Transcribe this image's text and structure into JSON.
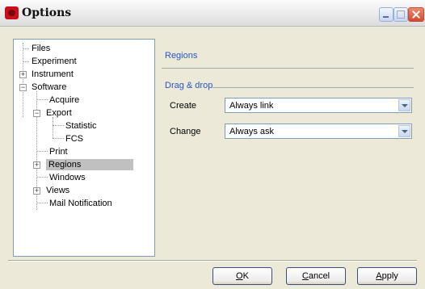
{
  "window": {
    "title": "Options"
  },
  "tree": {
    "items": [
      {
        "label": "Files"
      },
      {
        "label": "Experiment"
      },
      {
        "label": "Instrument"
      },
      {
        "label": "Software"
      },
      {
        "label": "Acquire"
      },
      {
        "label": "Export"
      },
      {
        "label": "Statistic"
      },
      {
        "label": "FCS"
      },
      {
        "label": "Print"
      },
      {
        "label": "Regions",
        "selected": true
      },
      {
        "label": "Windows"
      },
      {
        "label": "Views"
      },
      {
        "label": "Mail Notification"
      }
    ]
  },
  "panel": {
    "title": "Regions",
    "group_title": "Drag & drop",
    "fields": [
      {
        "label": "Create",
        "value": "Always link"
      },
      {
        "label": "Change",
        "value": "Always ask"
      }
    ]
  },
  "buttons": {
    "ok": {
      "mnemonic": "O",
      "rest": "K"
    },
    "cancel": {
      "mnemonic": "C",
      "rest": "ancel"
    },
    "apply": {
      "mnemonic": "A",
      "rest": "pply"
    }
  }
}
